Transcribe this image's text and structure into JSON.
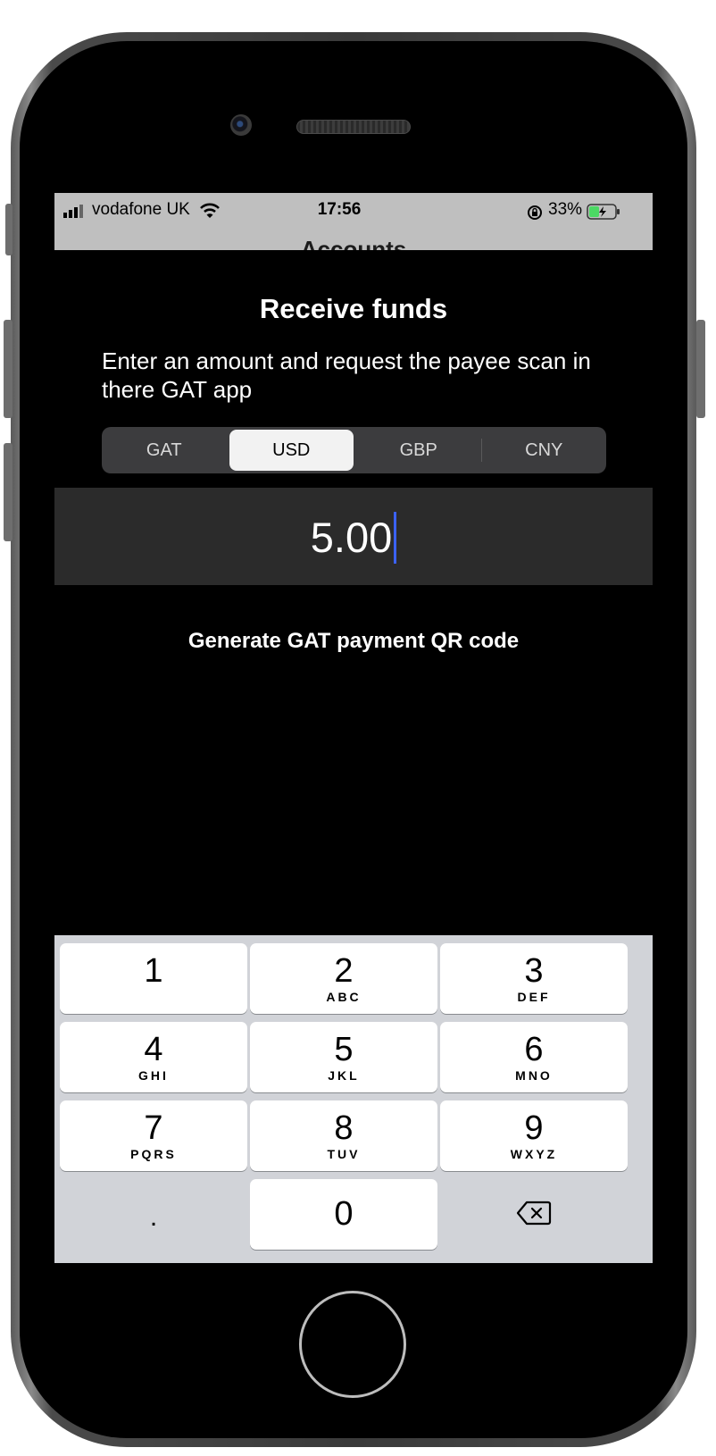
{
  "status_bar": {
    "carrier": "vodafone UK",
    "time": "17:56",
    "battery_percent": "33%",
    "icons": [
      "signal-icon",
      "wifi-icon",
      "orientation-lock-icon",
      "battery-charging-icon"
    ]
  },
  "background_screen": {
    "title": "Accounts"
  },
  "sheet": {
    "title": "Receive funds",
    "subtitle": "Enter an amount and request the payee scan in there GAT app",
    "currencies": [
      {
        "label": "GAT",
        "selected": false
      },
      {
        "label": "USD",
        "selected": true
      },
      {
        "label": "GBP",
        "selected": false
      },
      {
        "label": "CNY",
        "selected": false
      }
    ],
    "amount": "5.00",
    "generate_button": "Generate GAT payment QR code"
  },
  "keyboard": {
    "keys": [
      {
        "num": "1",
        "letters": ""
      },
      {
        "num": "2",
        "letters": "ABC"
      },
      {
        "num": "3",
        "letters": "DEF"
      },
      {
        "num": "4",
        "letters": "GHI"
      },
      {
        "num": "5",
        "letters": "JKL"
      },
      {
        "num": "6",
        "letters": "MNO"
      },
      {
        "num": "7",
        "letters": "PQRS"
      },
      {
        "num": "8",
        "letters": "TUV"
      },
      {
        "num": "9",
        "letters": "WXYZ"
      },
      {
        "num": ".",
        "letters": ""
      },
      {
        "num": "0",
        "letters": ""
      },
      {
        "num": "",
        "letters": "",
        "icon": "backspace-icon"
      }
    ]
  },
  "colors": {
    "caret": "#3b62ff",
    "keyboard_bg": "#d1d3d8",
    "segment_bg": "#3c3c3e"
  }
}
